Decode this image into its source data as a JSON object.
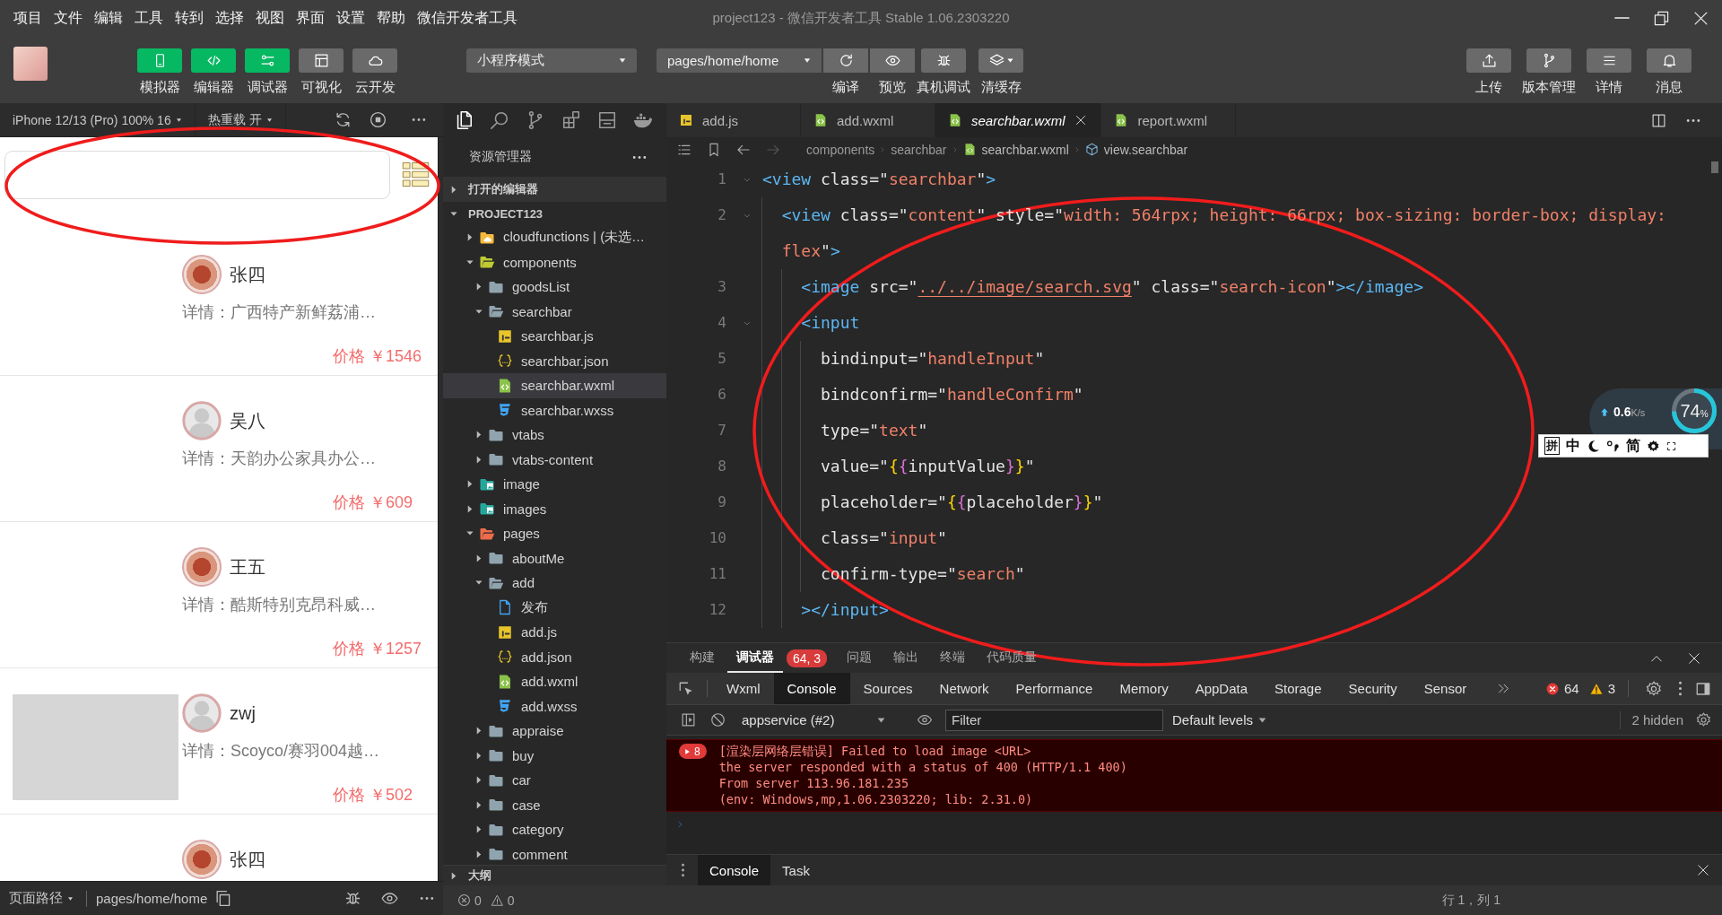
{
  "window": {
    "title": "project123 - 微信开发者工具 Stable 1.06.2303220"
  },
  "menu": [
    "项目",
    "文件",
    "编辑",
    "工具",
    "转到",
    "选择",
    "视图",
    "界面",
    "设置",
    "帮助",
    "微信开发者工具"
  ],
  "toolbar": {
    "views": [
      {
        "label": "模拟器",
        "on": true
      },
      {
        "label": "编辑器",
        "on": true
      },
      {
        "label": "调试器",
        "on": true
      },
      {
        "label": "可视化",
        "on": false
      },
      {
        "label": "云开发",
        "on": false
      }
    ],
    "mode": "小程序模式",
    "page": "pages/home/home",
    "actions": [
      "编译",
      "预览",
      "真机调试",
      "清缓存"
    ],
    "right": [
      "上传",
      "版本管理",
      "详情",
      "消息"
    ]
  },
  "simulator": {
    "device": "iPhone 12/13 (Pro) 100% 16",
    "hot_reload": "热重载 开",
    "items": [
      {
        "name": "张四",
        "detail": "详情：广西特产新鲜荔浦…",
        "price": "价格 ￥1546",
        "avatar": {
          "kind": "photo"
        },
        "has_photo": false
      },
      {
        "name": "吴八",
        "detail": "详情：天韵办公家具办公…",
        "price": "价格 ￥609",
        "avatar": {
          "kind": "default"
        },
        "has_photo": false
      },
      {
        "name": "王五",
        "detail": "详情：酷斯特别克昂科威…",
        "price": "价格 ￥1257",
        "avatar": {
          "kind": "photo"
        },
        "has_photo": false
      },
      {
        "name": "zwj",
        "detail": "详情：Scoyco/赛羽004越…",
        "price": "价格 ￥502",
        "avatar": {
          "kind": "default"
        },
        "has_photo": true
      },
      {
        "name": "张四",
        "avatar": {
          "kind": "photo"
        },
        "has_photo": false
      }
    ],
    "path_label": "页面路径",
    "path": "pages/home/home"
  },
  "explorer": {
    "title": "资源管理器",
    "open_editors": {
      "label": "打开的编辑器",
      "expanded": false
    },
    "project": {
      "label": "PROJECT123",
      "expanded": true
    },
    "tree": [
      {
        "label": "cloudfunctions | (未选…",
        "kind": "cloud-folder",
        "expanded": false,
        "selected": false
      },
      {
        "label": "components",
        "kind": "component-folder",
        "expanded": true,
        "selected": false,
        "children": [
          {
            "label": "goodsList",
            "kind": "folder",
            "expanded": false,
            "selected": false
          },
          {
            "label": "searchbar",
            "kind": "folder",
            "expanded": true,
            "selected": false,
            "children": [
              {
                "label": "searchbar.js",
                "kind": "js",
                "selected": false
              },
              {
                "label": "searchbar.json",
                "kind": "json",
                "selected": false
              },
              {
                "label": "searchbar.wxml",
                "kind": "wxml",
                "selected": true
              },
              {
                "label": "searchbar.wxss",
                "kind": "wxss",
                "selected": false
              }
            ]
          },
          {
            "label": "vtabs",
            "kind": "folder",
            "expanded": false,
            "selected": false
          },
          {
            "label": "vtabs-content",
            "kind": "folder",
            "expanded": false,
            "selected": false
          }
        ]
      },
      {
        "label": "image",
        "kind": "image-folder",
        "expanded": false,
        "selected": false
      },
      {
        "label": "images",
        "kind": "image-folder",
        "expanded": false,
        "selected": false
      },
      {
        "label": "pages",
        "kind": "pages-folder",
        "expanded": true,
        "selected": false,
        "children": [
          {
            "label": "aboutMe",
            "kind": "folder",
            "expanded": false,
            "selected": false
          },
          {
            "label": "add",
            "kind": "folder",
            "expanded": true,
            "selected": false,
            "children": [
              {
                "label": "发布",
                "kind": "doc",
                "selected": false
              },
              {
                "label": "add.js",
                "kind": "js",
                "selected": false
              },
              {
                "label": "add.json",
                "kind": "json",
                "selected": false
              },
              {
                "label": "add.wxml",
                "kind": "wxml",
                "selected": false
              },
              {
                "label": "add.wxss",
                "kind": "wxss",
                "selected": false
              }
            ]
          },
          {
            "label": "appraise",
            "kind": "folder",
            "expanded": false,
            "selected": false
          },
          {
            "label": "buy",
            "kind": "folder",
            "expanded": false,
            "selected": false
          },
          {
            "label": "car",
            "kind": "folder",
            "expanded": false,
            "selected": false
          },
          {
            "label": "case",
            "kind": "folder",
            "expanded": false,
            "selected": false
          },
          {
            "label": "category",
            "kind": "folder",
            "expanded": false,
            "selected": false
          },
          {
            "label": "comment",
            "kind": "folder",
            "expanded": false,
            "selected": false
          }
        ]
      }
    ],
    "outline": {
      "label": "大纲",
      "expanded": false
    }
  },
  "editor": {
    "tabs": [
      {
        "label": "add.js",
        "kind": "js",
        "selected": false
      },
      {
        "label": "add.wxml",
        "kind": "wxml",
        "selected": false
      },
      {
        "label": "searchbar.wxml",
        "kind": "wxml",
        "selected": true
      },
      {
        "label": "report.wxml",
        "kind": "wxml",
        "selected": false
      }
    ],
    "breadcrumb": [
      {
        "label": "components"
      },
      {
        "label": "searchbar"
      },
      {
        "label": "searchbar.wxml",
        "kind": "wxml"
      },
      {
        "label": "view.searchbar",
        "kind": "symbol"
      }
    ],
    "lines": [
      {
        "number": "1",
        "foldable": true,
        "tokens": [
          {
            "kind": "tag",
            "text": "<view"
          },
          {
            "kind": "attr",
            "text": " class"
          },
          {
            "kind": "punct",
            "text": "=\""
          },
          {
            "kind": "string",
            "text": "searchbar"
          },
          {
            "kind": "punct",
            "text": "\""
          },
          {
            "kind": "tag",
            "text": ">"
          }
        ],
        "children": [
          {
            "number": "2",
            "foldable": true,
            "tokens": [
              {
                "kind": "tag",
                "text": "<view"
              },
              {
                "kind": "attr",
                "text": " class"
              },
              {
                "kind": "punct",
                "text": "=\""
              },
              {
                "kind": "string",
                "text": "content"
              },
              {
                "kind": "punct",
                "text": "\""
              },
              {
                "kind": "attr",
                "text": " style"
              },
              {
                "kind": "punct",
                "text": "=\""
              },
              {
                "kind": "string",
                "text": "width: 564rpx; height: 66rpx; box-sizing: border-box; display: flex"
              },
              {
                "kind": "punct",
                "text": "\""
              },
              {
                "kind": "tag",
                "text": ">"
              }
            ],
            "children": [
              {
                "number": "3",
                "foldable": false,
                "tokens": [
                  {
                    "kind": "tag",
                    "text": "<image"
                  },
                  {
                    "kind": "attr",
                    "text": " src"
                  },
                  {
                    "kind": "punct",
                    "text": "=\""
                  },
                  {
                    "kind": "link",
                    "text": "../../image/search.svg"
                  },
                  {
                    "kind": "punct",
                    "text": "\""
                  },
                  {
                    "kind": "attr",
                    "text": " class"
                  },
                  {
                    "kind": "punct",
                    "text": "=\""
                  },
                  {
                    "kind": "string",
                    "text": "search-icon"
                  },
                  {
                    "kind": "punct",
                    "text": "\""
                  },
                  {
                    "kind": "tag",
                    "text": "></image>"
                  }
                ]
              },
              {
                "number": "4",
                "foldable": true,
                "tokens": [
                  {
                    "kind": "tag",
                    "text": "<input"
                  }
                ],
                "children": [
                  {
                    "number": "5",
                    "foldable": false,
                    "tokens": [
                      {
                        "kind": "attr",
                        "text": "bindinput"
                      },
                      {
                        "kind": "punct",
                        "text": "=\""
                      },
                      {
                        "kind": "string",
                        "text": "handleInput"
                      },
                      {
                        "kind": "punct",
                        "text": "\""
                      }
                    ]
                  },
                  {
                    "number": "6",
                    "foldable": false,
                    "tokens": [
                      {
                        "kind": "attr",
                        "text": "bindconfirm"
                      },
                      {
                        "kind": "punct",
                        "text": "=\""
                      },
                      {
                        "kind": "string",
                        "text": "handleConfirm"
                      },
                      {
                        "kind": "punct",
                        "text": "\""
                      }
                    ]
                  },
                  {
                    "number": "7",
                    "foldable": false,
                    "tokens": [
                      {
                        "kind": "attr",
                        "text": "type"
                      },
                      {
                        "kind": "punct",
                        "text": "=\""
                      },
                      {
                        "kind": "string",
                        "text": "text"
                      },
                      {
                        "kind": "punct",
                        "text": "\""
                      }
                    ]
                  },
                  {
                    "number": "8",
                    "foldable": false,
                    "tokens": [
                      {
                        "kind": "attr",
                        "text": "value"
                      },
                      {
                        "kind": "punct",
                        "text": "=\""
                      },
                      {
                        "kind": "brace1",
                        "text": "{"
                      },
                      {
                        "kind": "brace2",
                        "text": "{"
                      },
                      {
                        "kind": "text",
                        "text": "inputValue"
                      },
                      {
                        "kind": "brace2",
                        "text": "}"
                      },
                      {
                        "kind": "brace1",
                        "text": "}"
                      },
                      {
                        "kind": "punct",
                        "text": "\""
                      }
                    ]
                  },
                  {
                    "number": "9",
                    "foldable": false,
                    "tokens": [
                      {
                        "kind": "attr",
                        "text": "placeholder"
                      },
                      {
                        "kind": "punct",
                        "text": "=\""
                      },
                      {
                        "kind": "brace1",
                        "text": "{"
                      },
                      {
                        "kind": "brace2",
                        "text": "{"
                      },
                      {
                        "kind": "text",
                        "text": "placeholder"
                      },
                      {
                        "kind": "brace2",
                        "text": "}"
                      },
                      {
                        "kind": "brace1",
                        "text": "}"
                      },
                      {
                        "kind": "punct",
                        "text": "\""
                      }
                    ]
                  },
                  {
                    "number": "10",
                    "foldable": false,
                    "tokens": [
                      {
                        "kind": "attr",
                        "text": "class"
                      },
                      {
                        "kind": "punct",
                        "text": "=\""
                      },
                      {
                        "kind": "string",
                        "text": "input"
                      },
                      {
                        "kind": "punct",
                        "text": "\""
                      }
                    ]
                  },
                  {
                    "number": "11",
                    "foldable": false,
                    "tokens": [
                      {
                        "kind": "attr",
                        "text": "confirm-type"
                      },
                      {
                        "kind": "punct",
                        "text": "=\""
                      },
                      {
                        "kind": "string",
                        "text": "search"
                      },
                      {
                        "kind": "punct",
                        "text": "\""
                      }
                    ]
                  }
                ]
              },
              {
                "number": "12",
                "foldable": false,
                "tokens": [
                  {
                    "kind": "tag",
                    "text": "></input>"
                  }
                ]
              }
            ]
          }
        ]
      }
    ]
  },
  "panel": {
    "tabs": [
      {
        "label": "构建",
        "selected": false
      },
      {
        "label": "调试器",
        "selected": true,
        "badge": "64, 3"
      },
      {
        "label": "问题",
        "selected": false
      },
      {
        "label": "输出",
        "selected": false
      },
      {
        "label": "终端",
        "selected": false
      },
      {
        "label": "代码质量",
        "selected": false
      }
    ]
  },
  "devtools": {
    "tabs": [
      {
        "label": "Wxml",
        "selected": false
      },
      {
        "label": "Console",
        "selected": true
      },
      {
        "label": "Sources",
        "selected": false
      },
      {
        "label": "Network",
        "selected": false
      },
      {
        "label": "Performance",
        "selected": false
      },
      {
        "label": "Memory",
        "selected": false
      },
      {
        "label": "AppData",
        "selected": false
      },
      {
        "label": "Storage",
        "selected": false
      },
      {
        "label": "Security",
        "selected": false
      },
      {
        "label": "Sensor",
        "selected": false
      }
    ],
    "error_count": "64",
    "warning_count": "3",
    "context": "appservice (#2)",
    "filter": {
      "placeholder": "Filter"
    },
    "levels": "Default levels",
    "hidden": "2 hidden"
  },
  "console": {
    "messages": [
      {
        "kind": "error",
        "count": "8",
        "lines": [
          "[渲染层网络层错误] Failed to load image <URL>",
          "the server responded with a status of 400 (HTTP/1.1 400)",
          "From server 113.96.181.235",
          "(env: Windows,mp,1.06.2303220; lib: 2.31.0)"
        ]
      }
    ]
  },
  "drawer": {
    "tabs": [
      {
        "label": "Console",
        "selected": true
      },
      {
        "label": "Task",
        "selected": false
      }
    ]
  },
  "status_bar": {
    "errors": "0",
    "warnings": "0",
    "position": "行 1，列 1"
  },
  "net_monitor": {
    "speed": "0.6",
    "unit": "K/s",
    "percent": "74",
    "percent_unit": "%",
    "level": 0.74
  },
  "ime_bar": {
    "input_method": "拼",
    "language": "中",
    "script": "简"
  }
}
